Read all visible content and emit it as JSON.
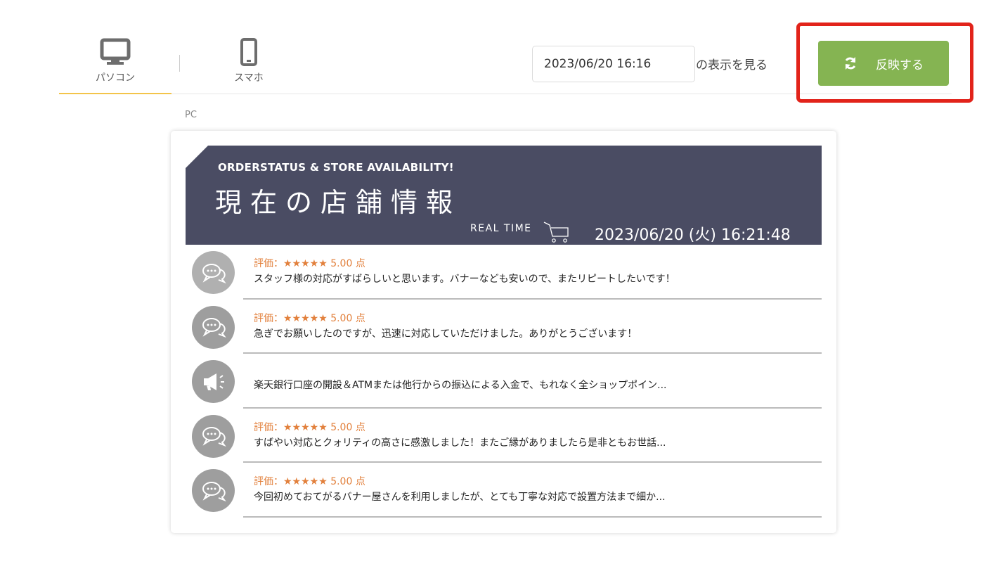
{
  "tabs": [
    {
      "label": "パソコン",
      "icon": "monitor-icon",
      "active": true
    },
    {
      "label": "スマホ",
      "icon": "smartphone-icon",
      "active": false
    }
  ],
  "datetime_input": {
    "value": "2023/06/20 16:16"
  },
  "datetime_suffix": "の表示を見る",
  "reflect_button": {
    "label": "反映する",
    "icon": "refresh-icon",
    "color": "#85b452"
  },
  "highlight_color": "#e2231a",
  "preview": {
    "caption": "PC",
    "banner": {
      "subtitle": "ORDERSTATUS & STORE AVAILABILITY!",
      "title": "現在の店舗情報",
      "realtime_label": "REAL TIME",
      "datetime": "2023/06/20 (火) 16:21:48",
      "background": "#4a4c63"
    },
    "items": [
      {
        "icon": "chat-bubbles-icon",
        "rating": "評価：★★★★★ 5.00 点",
        "text": "スタッフ様の対応がすばらしいと思います。バナーなども安いので、またリピートしたいです！"
      },
      {
        "icon": "chat-bubbles-icon",
        "rating": "評価：★★★★★ 5.00 点",
        "text": "急ぎでお願いしたのですが、迅速に対応していただけました。ありがとうございます！"
      },
      {
        "icon": "megaphone-icon",
        "rating": "",
        "text": "楽天銀行口座の開設＆ATMまたは他行からの振込による入金で、もれなく全ショップポイン..."
      },
      {
        "icon": "chat-bubbles-icon",
        "rating": "評価：★★★★★ 5.00 点",
        "text": "すばやい対応とクォリティの高さに感激しました！またご縁がありましたら是非ともお世話..."
      },
      {
        "icon": "chat-bubbles-icon",
        "rating": "評価：★★★★★ 5.00 点",
        "text": "今回初めておてがるバナー屋さんを利用しましたが、とても丁寧な対応で設置方法まで細か..."
      }
    ]
  }
}
